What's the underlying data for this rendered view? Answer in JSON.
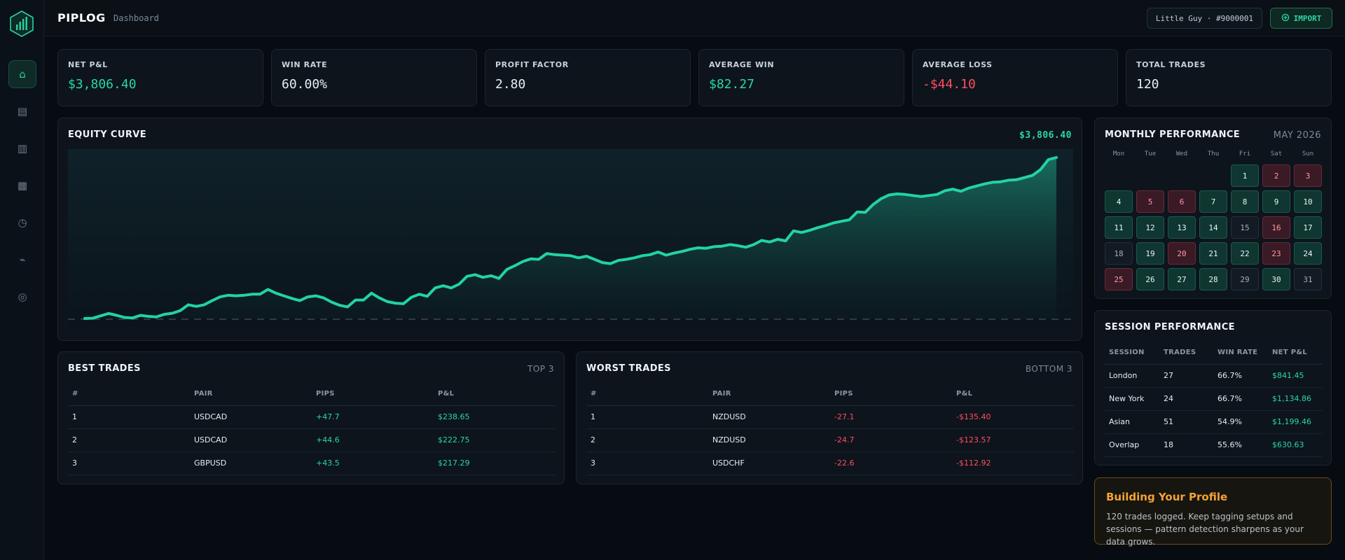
{
  "app": {
    "brand": "PIPLOG",
    "breadcrumb": "Dashboard"
  },
  "sidebar": {
    "items": [
      {
        "name": "home",
        "icon": "⌂",
        "active": true
      },
      {
        "name": "journal",
        "icon": "▤",
        "active": false
      },
      {
        "name": "trades",
        "icon": "▥",
        "active": false
      },
      {
        "name": "calendar",
        "icon": "▦",
        "active": false
      },
      {
        "name": "sessions",
        "icon": "◷",
        "active": false
      },
      {
        "name": "analytics",
        "icon": "⌁",
        "active": false
      },
      {
        "name": "settings",
        "icon": "◎",
        "active": false
      }
    ]
  },
  "header": {
    "user": "Little Guy · #9000001",
    "import_label": "IMPORT"
  },
  "kpis": [
    {
      "label": "NET P&L",
      "value": "$3,806.40",
      "tone": "green"
    },
    {
      "label": "WIN RATE",
      "value": "60.00%",
      "tone": "neutral"
    },
    {
      "label": "PROFIT FACTOR",
      "value": "2.80",
      "tone": "neutral"
    },
    {
      "label": "AVERAGE WIN",
      "value": "$82.27",
      "tone": "green"
    },
    {
      "label": "AVERAGE LOSS",
      "value": "-$44.10",
      "tone": "red"
    },
    {
      "label": "TOTAL TRADES",
      "value": "120",
      "tone": "neutral"
    }
  ],
  "equity": {
    "title": "EQUITY CURVE",
    "final_value": "$3,806.40",
    "line_color": "#22d3a4",
    "values": [
      0,
      5,
      50,
      95,
      60,
      20,
      10,
      60,
      40,
      30,
      80,
      100,
      150,
      260,
      230,
      260,
      340,
      410,
      440,
      430,
      440,
      460,
      460,
      550,
      480,
      430,
      380,
      340,
      410,
      430,
      390,
      310,
      250,
      220,
      350,
      350,
      480,
      390,
      320,
      290,
      280,
      400,
      460,
      420,
      580,
      620,
      580,
      650,
      800,
      830,
      780,
      810,
      760,
      930,
      1000,
      1080,
      1130,
      1120,
      1230,
      1210,
      1200,
      1190,
      1150,
      1180,
      1120,
      1060,
      1040,
      1100,
      1120,
      1150,
      1190,
      1210,
      1260,
      1200,
      1240,
      1270,
      1310,
      1340,
      1330,
      1360,
      1370,
      1400,
      1380,
      1350,
      1400,
      1480,
      1450,
      1500,
      1470,
      1660,
      1630,
      1670,
      1720,
      1760,
      1810,
      1840,
      1870,
      2020,
      2010,
      2160,
      2270,
      2340,
      2360,
      2350,
      2330,
      2310,
      2330,
      2350,
      2420,
      2450,
      2410,
      2470,
      2510,
      2550,
      2580,
      2590,
      2620,
      2630,
      2670,
      2710,
      2820,
      3010,
      3050
    ]
  },
  "best_trades": {
    "title": "BEST TRADES",
    "tag": "TOP 3",
    "columns": [
      "#",
      "PAIR",
      "PIPS",
      "P&L"
    ],
    "rows": [
      {
        "n": "1",
        "pair": "USDCAD",
        "pips": "+47.7",
        "pnl": "$238.65"
      },
      {
        "n": "2",
        "pair": "USDCAD",
        "pips": "+44.6",
        "pnl": "$222.75"
      },
      {
        "n": "3",
        "pair": "GBPUSD",
        "pips": "+43.5",
        "pnl": "$217.29"
      }
    ]
  },
  "worst_trades": {
    "title": "WORST TRADES",
    "tag": "BOTTOM 3",
    "columns": [
      "#",
      "PAIR",
      "PIPS",
      "P&L"
    ],
    "rows": [
      {
        "n": "1",
        "pair": "NZDUSD",
        "pips": "-27.1",
        "pnl": "-$135.40"
      },
      {
        "n": "2",
        "pair": "NZDUSD",
        "pips": "-24.7",
        "pnl": "-$123.57"
      },
      {
        "n": "3",
        "pair": "USDCHF",
        "pips": "-22.6",
        "pnl": "-$112.92"
      }
    ]
  },
  "monthly": {
    "title": "MONTHLY PERFORMANCE",
    "month": "MAY 2026",
    "weekdays": [
      "Mon",
      "Tue",
      "Wed",
      "Thu",
      "Fri",
      "Sat",
      "Sun"
    ],
    "leading_blanks": 4,
    "days": [
      {
        "d": "1",
        "s": "win"
      },
      {
        "d": "2",
        "s": "loss"
      },
      {
        "d": "3",
        "s": "loss"
      },
      {
        "d": "4",
        "s": "win"
      },
      {
        "d": "5",
        "s": "loss"
      },
      {
        "d": "6",
        "s": "loss"
      },
      {
        "d": "7",
        "s": "win"
      },
      {
        "d": "8",
        "s": "win"
      },
      {
        "d": "9",
        "s": "win"
      },
      {
        "d": "10",
        "s": "win"
      },
      {
        "d": "11",
        "s": "win"
      },
      {
        "d": "12",
        "s": "win"
      },
      {
        "d": "13",
        "s": "win"
      },
      {
        "d": "14",
        "s": "win"
      },
      {
        "d": "15",
        "s": "neutral"
      },
      {
        "d": "16",
        "s": "loss"
      },
      {
        "d": "17",
        "s": "win"
      },
      {
        "d": "18",
        "s": "neutral"
      },
      {
        "d": "19",
        "s": "win"
      },
      {
        "d": "20",
        "s": "loss"
      },
      {
        "d": "21",
        "s": "win"
      },
      {
        "d": "22",
        "s": "win"
      },
      {
        "d": "23",
        "s": "loss"
      },
      {
        "d": "24",
        "s": "win"
      },
      {
        "d": "25",
        "s": "loss"
      },
      {
        "d": "26",
        "s": "win"
      },
      {
        "d": "27",
        "s": "win"
      },
      {
        "d": "28",
        "s": "win"
      },
      {
        "d": "29",
        "s": "neutral"
      },
      {
        "d": "30",
        "s": "win"
      },
      {
        "d": "31",
        "s": "neutral"
      }
    ]
  },
  "sessions": {
    "title": "SESSION PERFORMANCE",
    "columns": [
      "SESSION",
      "TRADES",
      "WIN RATE",
      "NET P&L"
    ],
    "rows": [
      {
        "session": "London",
        "trades": "27",
        "win_rate": "66.7%",
        "pnl": "$841.45"
      },
      {
        "session": "New York",
        "trades": "24",
        "win_rate": "66.7%",
        "pnl": "$1,134.86"
      },
      {
        "session": "Asian",
        "trades": "51",
        "win_rate": "54.9%",
        "pnl": "$1,199.46"
      },
      {
        "session": "Overlap",
        "trades": "18",
        "win_rate": "55.6%",
        "pnl": "$630.63"
      }
    ]
  },
  "profile": {
    "title": "Building Your Profile",
    "text": "120 trades logged. Keep tagging setups and sessions — pattern detection sharpens as your data grows."
  }
}
